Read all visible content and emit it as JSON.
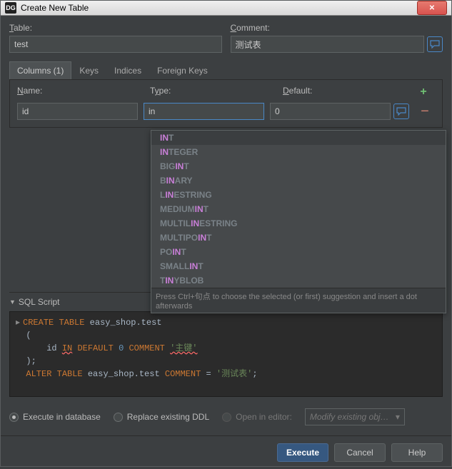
{
  "window": {
    "title": "Create New Table",
    "app_icon_text": "DG"
  },
  "form": {
    "table_label": "Table:",
    "table_value": "test",
    "comment_label": "Comment:",
    "comment_value": "测试表"
  },
  "tabs": {
    "columns": "Columns (1)",
    "keys": "Keys",
    "indices": "Indices",
    "foreign_keys": "Foreign Keys"
  },
  "columns_panel": {
    "name_label": "Name:",
    "type_label": "Type:",
    "default_label": "Default:",
    "row": {
      "name": "id",
      "type": "in",
      "default": "0"
    },
    "add_symbol": "+",
    "remove_symbol": "−"
  },
  "autocomplete": {
    "items": [
      {
        "hl": "IN",
        "rest": "T"
      },
      {
        "hl": "IN",
        "rest": "TEGER"
      },
      {
        "pre": "BIG",
        "hl": "IN",
        "rest": "T"
      },
      {
        "pre": "B",
        "hl": "IN",
        "rest": "ARY"
      },
      {
        "pre": "L",
        "hl": "IN",
        "rest": "ESTRING"
      },
      {
        "pre": "MEDIUM",
        "hl": "IN",
        "rest": "T"
      },
      {
        "pre": "MULTIL",
        "hl": "IN",
        "rest": "ESTRING"
      },
      {
        "pre": "MULTIPO",
        "hl": "IN",
        "rest": "T"
      },
      {
        "pre": "PO",
        "hl": "IN",
        "rest": "T"
      },
      {
        "pre": "SMALL",
        "hl": "IN",
        "rest": "T"
      },
      {
        "pre": "T",
        "hl": "IN",
        "rest": "YBLOB"
      }
    ],
    "hint": "Press Ctrl+句点 to choose the selected (or first) suggestion and insert a dot afterwards"
  },
  "sql": {
    "header": "SQL Script",
    "tokens": {
      "create": "CREATE",
      "table": "TABLE",
      "schema": "easy_shop.test",
      "col": "id",
      "in": "IN",
      "default": "DEFAULT",
      "zero": "0",
      "comment_kw": "COMMENT",
      "pk_comment": "'主键'",
      "alter": "ALTER",
      "eq": "=",
      "table_comment": "'测试表'",
      "lparen": "(",
      "rparen": ");",
      "semi": ";"
    }
  },
  "options": {
    "execute_db": "Execute in database",
    "replace_ddl": "Replace existing DDL",
    "open_editor": "Open in editor:",
    "modify_placeholder": "Modify existing obj…"
  },
  "buttons": {
    "execute": "Execute",
    "cancel": "Cancel",
    "help": "Help"
  }
}
